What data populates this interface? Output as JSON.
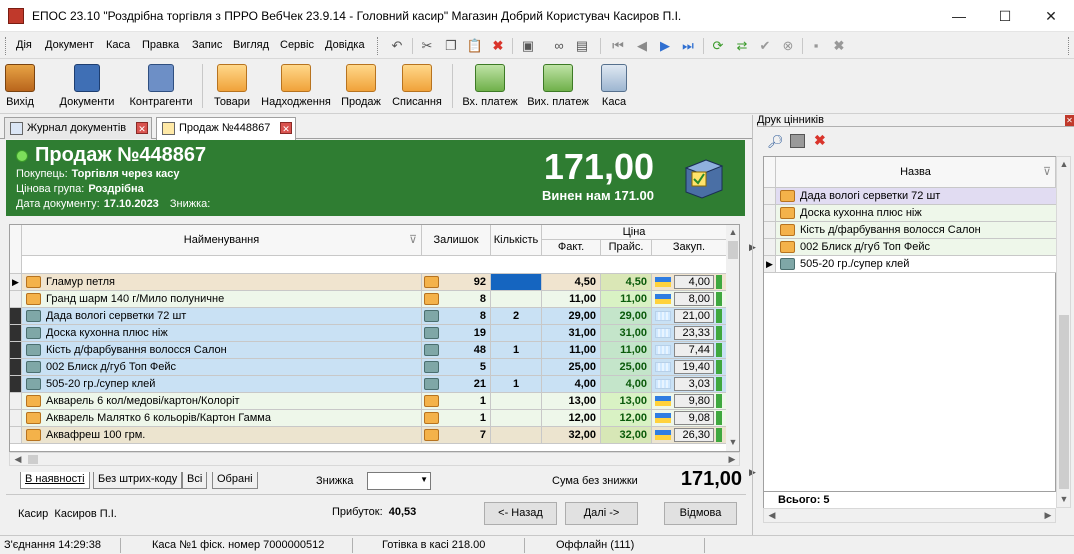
{
  "window": {
    "title": "ЕПОС 23.10 \"Роздрібна торгівля з ПРРО ВебЧек 23.9.14 - Головний касир\" Магазин Добрий  Користувач Касиров П.І.",
    "minimize": "—",
    "maximize": "☐",
    "close": "✕"
  },
  "menu": [
    "Дія",
    "Документ",
    "Каса",
    "Правка",
    "Запис",
    "Вигляд",
    "Сервіс",
    "Довідка"
  ],
  "toolbar_icons": [
    "undo-icon",
    "cut-icon",
    "copy-icon",
    "paste-icon",
    "delete-icon",
    "preview-icon",
    "binoculars-icon",
    "print-setup-icon",
    "first-icon",
    "prev-icon",
    "next-icon",
    "last-icon",
    "refresh-icon",
    "refresh-list-icon",
    "confirm-icon",
    "cancel-icon",
    "save-icon",
    "close-doc-icon"
  ],
  "big_toolbar": [
    {
      "label": "Вихід",
      "icon": "exit-icon"
    },
    {
      "label": "Документи",
      "icon": "documents-icon"
    },
    {
      "label": "Контрагенти",
      "icon": "contractors-icon"
    },
    {
      "label": "Товари",
      "icon": "goods-icon"
    },
    {
      "label": "Надходження",
      "icon": "receipt-icon"
    },
    {
      "label": "Продаж",
      "icon": "sale-icon"
    },
    {
      "label": "Списання",
      "icon": "writeoff-icon"
    },
    {
      "label": "Вх. платеж",
      "icon": "incoming-payment-icon"
    },
    {
      "label": "Вих. платеж",
      "icon": "outgoing-payment-icon"
    },
    {
      "label": "Каса",
      "icon": "cash-icon"
    }
  ],
  "tabs": [
    {
      "label": "Журнал документів",
      "close": "✕"
    },
    {
      "label": "Продаж №448867",
      "close": "✕"
    }
  ],
  "doc": {
    "title": "Продаж №448867",
    "buyer_label": "Покупець:",
    "buyer": "Торгівля через касу",
    "price_group_label": "Цінова група:",
    "price_group": "Роздрібна",
    "date_label": "Дата документу:",
    "date": "17.10.2023",
    "discount_label": "Знижка:",
    "total": "171,00",
    "due": "Винен нам 171.00"
  },
  "grid": {
    "headers": {
      "name": "Найменування",
      "stock": "Залишок",
      "qty": "Кількість",
      "price": "Ціна",
      "fact": "Факт.",
      "list": "Прайс.",
      "purchase": "Закуп."
    },
    "rows": [
      {
        "name": "Гламур петля",
        "stock": "92",
        "qty": "",
        "fact": "4,50",
        "list": "4,50",
        "purchase": "4,00",
        "bg": "#f0e4cf",
        "icon": "orange",
        "current": true
      },
      {
        "name": "Гранд шарм 140 г/Мило полуничне",
        "stock": "8",
        "qty": "",
        "fact": "11,00",
        "list": "11,00",
        "purchase": "8,00",
        "bg": "#eef7ea",
        "icon": "orange"
      },
      {
        "name": "Дада вологі серветки 72 шт",
        "stock": "8",
        "qty": "2",
        "fact": "29,00",
        "list": "29,00",
        "purchase": "21,00",
        "bg": "#c9e1f4",
        "icon": "teal",
        "marked": true
      },
      {
        "name": "Доска кухонна плюс ніж",
        "stock": "19",
        "qty": "",
        "fact": "31,00",
        "list": "31,00",
        "purchase": "23,33",
        "bg": "#c9e1f4",
        "icon": "teal",
        "marked": true
      },
      {
        "name": "Кість д/фарбування волосся Салон",
        "stock": "48",
        "qty": "1",
        "fact": "11,00",
        "list": "11,00",
        "purchase": "7,44",
        "bg": "#c9e1f4",
        "icon": "teal",
        "marked": true
      },
      {
        "name": "002 Блиск д/губ Топ Фейс",
        "stock": "5",
        "qty": "",
        "fact": "25,00",
        "list": "25,00",
        "purchase": "19,40",
        "bg": "#c9e1f4",
        "icon": "teal",
        "marked": true
      },
      {
        "name": "505-20 гр./супер клей",
        "stock": "21",
        "qty": "1",
        "fact": "4,00",
        "list": "4,00",
        "purchase": "3,03",
        "bg": "#c9e1f4",
        "icon": "teal",
        "marked": true
      },
      {
        "name": "Акварель 6 кол/медові/картон/Колорiт",
        "stock": "1",
        "qty": "",
        "fact": "13,00",
        "list": "13,00",
        "purchase": "9,80",
        "bg": "#eef7ea",
        "icon": "orange"
      },
      {
        "name": "Акварель Малятко 6 кольорів/Картон Гамма",
        "stock": "1",
        "qty": "",
        "fact": "12,00",
        "list": "12,00",
        "purchase": "9,08",
        "bg": "#eef7ea",
        "icon": "orange"
      },
      {
        "name": "Аквафреш 100 грм.",
        "stock": "7",
        "qty": "",
        "fact": "32,00",
        "list": "32,00",
        "purchase": "26,30",
        "bg": "#ece4cf",
        "icon": "orange"
      }
    ]
  },
  "bottom_tabs": [
    "В наявності",
    "Без штрих-коду",
    "Всі",
    "Обрані"
  ],
  "discount_label": "Знижка",
  "sum_label": "Сума  без знижки",
  "sum_value": "171,00",
  "cashier_label": "Касир",
  "cashier": "Касиров П.І.",
  "profit_label": "Прибуток:",
  "profit": "40,53",
  "buttons": {
    "back": "<- Назад",
    "next": "Далі ->",
    "cancel": "Відмова"
  },
  "right_panel": {
    "title": "Друк цінників",
    "column": "Назва",
    "items": [
      {
        "name": "Дада вологі серветки 72 шт",
        "bg": "#e1dcf2"
      },
      {
        "name": "Доска кухонна плюс ніж",
        "bg": "#eef7ea"
      },
      {
        "name": "Кість д/фарбування волосся Салон",
        "bg": "#eef7ea"
      },
      {
        "name": "002 Блиск д/губ Топ Фейс",
        "bg": "#eef7ea"
      },
      {
        "name": "505-20 гр./супер клей",
        "bg": "#ffffff",
        "current": true
      }
    ],
    "total": "Всього: 5"
  },
  "status": {
    "connection": "З'єднання 14:29:38",
    "register": "Каса №1 фіск. номер 7000000512",
    "cash": "Готівка в касі 218.00",
    "mode": "Оффлайн (111)"
  }
}
